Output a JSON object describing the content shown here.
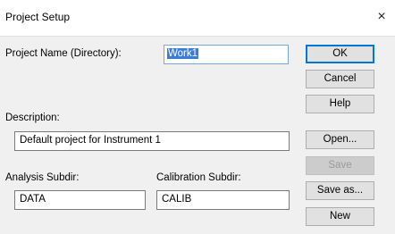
{
  "window": {
    "title": "Project Setup",
    "close_glyph": "×"
  },
  "form": {
    "project_name_label": "Project Name (Directory):",
    "project_name_value": "Work1",
    "description_label": "Description:",
    "description_value": "Default project for Instrument 1",
    "analysis_label": "Analysis Subdir:",
    "analysis_value": "DATA",
    "calibration_label": "Calibration Subdir:",
    "calibration_value": "CALIB"
  },
  "buttons": {
    "ok": "OK",
    "cancel": "Cancel",
    "help": "Help",
    "open": "Open...",
    "save": "Save",
    "save_as": "Save as...",
    "new": "New"
  }
}
